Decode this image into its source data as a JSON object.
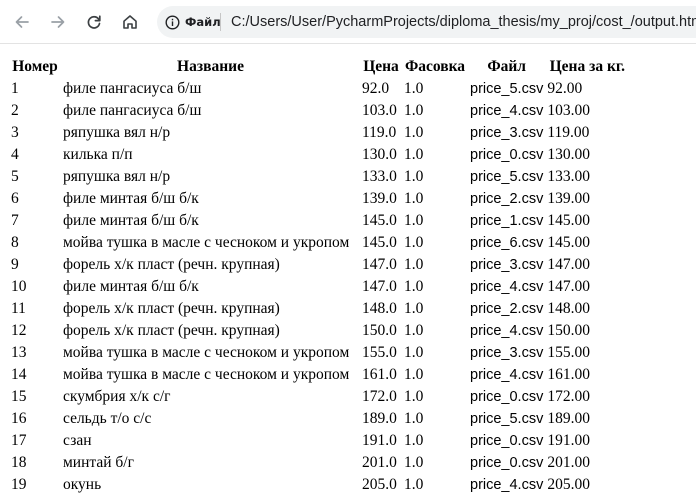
{
  "browser": {
    "site_label": "Файл",
    "url": "C:/Users/User/PycharmProjects/diploma_thesis/my_proj/cost_/output.html"
  },
  "table": {
    "headers": [
      "Номер",
      "Название",
      "Цена",
      "Фасовка",
      "Файл",
      "Цена за кг."
    ],
    "rows": [
      [
        "1",
        "филе пангасиуса б/ш",
        "92.0",
        "1.0",
        "price_5.csv",
        "92.00"
      ],
      [
        "2",
        "филе пангасиуса б/ш",
        "103.0",
        "1.0",
        "price_4.csv",
        "103.00"
      ],
      [
        "3",
        "ряпушка вял н/р",
        "119.0",
        "1.0",
        "price_3.csv",
        "119.00"
      ],
      [
        "4",
        "килька п/п",
        "130.0",
        "1.0",
        "price_0.csv",
        "130.00"
      ],
      [
        "5",
        "ряпушка вял н/р",
        "133.0",
        "1.0",
        "price_5.csv",
        "133.00"
      ],
      [
        "6",
        "филе минтая б/ш б/к",
        "139.0",
        "1.0",
        "price_2.csv",
        "139.00"
      ],
      [
        "7",
        "филе минтая б/ш б/к",
        "145.0",
        "1.0",
        "price_1.csv",
        "145.00"
      ],
      [
        "8",
        "мойва тушка в масле с чесноком и укропом",
        "145.0",
        "1.0",
        "price_6.csv",
        "145.00"
      ],
      [
        "9",
        "форель х/к пласт (речн. крупная)",
        "147.0",
        "1.0",
        "price_3.csv",
        "147.00"
      ],
      [
        "10",
        "филе минтая б/ш б/к",
        "147.0",
        "1.0",
        "price_4.csv",
        "147.00"
      ],
      [
        "11",
        "форель х/к пласт (речн. крупная)",
        "148.0",
        "1.0",
        "price_2.csv",
        "148.00"
      ],
      [
        "12",
        "форель х/к пласт (речн. крупная)",
        "150.0",
        "1.0",
        "price_4.csv",
        "150.00"
      ],
      [
        "13",
        "мойва тушка в масле с чесноком и укропом",
        "155.0",
        "1.0",
        "price_3.csv",
        "155.00"
      ],
      [
        "14",
        "мойва тушка в масле с чесноком и укропом",
        "161.0",
        "1.0",
        "price_4.csv",
        "161.00"
      ],
      [
        "15",
        "скумбрия х/к с/г",
        "172.0",
        "1.0",
        "price_0.csv",
        "172.00"
      ],
      [
        "16",
        "сельдь т/о с/с",
        "189.0",
        "1.0",
        "price_5.csv",
        "189.00"
      ],
      [
        "17",
        "сзан",
        "191.0",
        "1.0",
        "price_0.csv",
        "191.00"
      ],
      [
        "18",
        "минтай б/г",
        "201.0",
        "1.0",
        "price_0.csv",
        "201.00"
      ],
      [
        "19",
        "окунь",
        "205.0",
        "1.0",
        "price_4.csv",
        "205.00"
      ]
    ]
  }
}
